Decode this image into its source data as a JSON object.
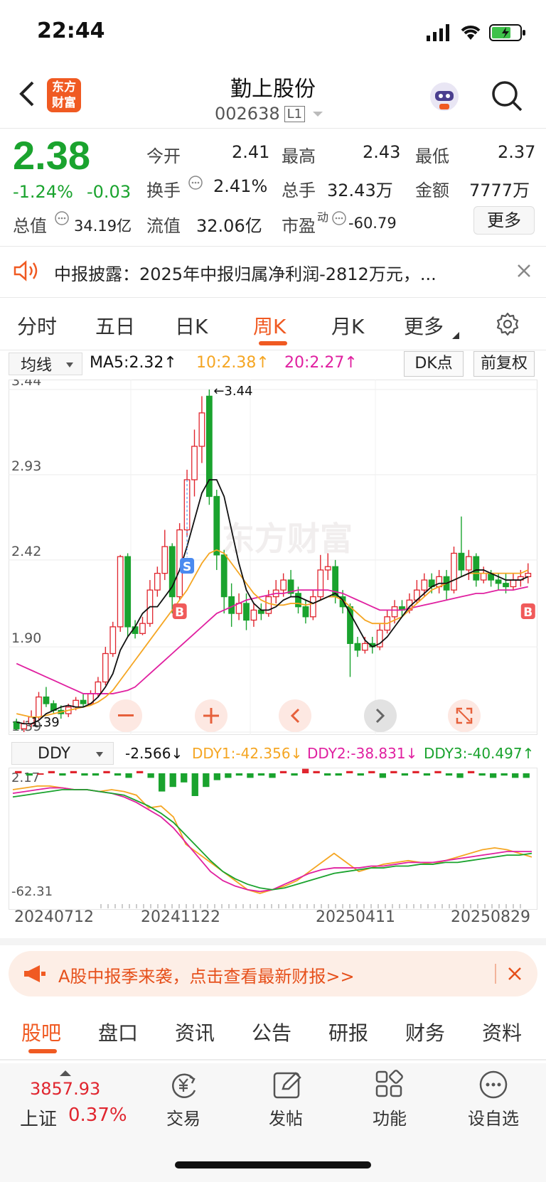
{
  "status_bar": {
    "time": "22:44"
  },
  "header": {
    "title": "勤上股份",
    "code": "002638",
    "level": "L1",
    "logo_line1": "东方",
    "logo_line2": "财富"
  },
  "quote": {
    "price": "2.38",
    "change_pct": "-1.24%",
    "change": "-0.03",
    "open_label": "今开",
    "open": "2.41",
    "high_label": "最高",
    "high": "2.43",
    "low_label": "最低",
    "low": "2.37",
    "turnover_label": "换手",
    "turnover": "2.41%",
    "volume_label": "总手",
    "volume": "32.43万",
    "amount_label": "金额",
    "amount": "7777万",
    "mktcap_label": "总值",
    "mktcap": "34.19亿",
    "float_label": "流值",
    "float": "32.06亿",
    "pe_label": "市盈",
    "pe_sup": "动",
    "pe": "-60.79",
    "more": "更多"
  },
  "notice": {
    "text": "中报披露：2025年中报归属净利润-2812万元，..."
  },
  "chart_tabs": [
    "分时",
    "五日",
    "日K",
    "周K",
    "月K",
    "更多"
  ],
  "active_tab": "周K",
  "ma_bar": {
    "select": "均线",
    "ma5": "MA5:2.32↑",
    "ma10": "10:2.38↑",
    "ma20": "20:2.27↑",
    "dk": "DK点",
    "adjust": "前复权"
  },
  "kline": {
    "y_labels": [
      "3.44",
      "2.93",
      "2.42",
      "1.90",
      "1.39"
    ],
    "high_marker": "←3.44",
    "low_marker": "1.39",
    "watermark": "东方财富",
    "signals": {
      "s": "S",
      "b": "B"
    }
  },
  "ddy_bar": {
    "select": "DDY",
    "ddy": "-2.566↓",
    "ddy1": "DDY1:-42.356↓",
    "ddy2": "DDY2:-38.831↓",
    "ddy3": "DDY3:-40.497↑"
  },
  "ddy_chart": {
    "top": "2.17",
    "bottom": "-62.31"
  },
  "dates": [
    "20240712",
    "20241122",
    "20250411",
    "20250829"
  ],
  "banner": {
    "text": "A股中报季来袭，点击查看最新财报>>"
  },
  "sub_tabs": [
    "股吧",
    "盘口",
    "资讯",
    "公告",
    "研报",
    "财务",
    "资料"
  ],
  "active_sub_tab": "股吧",
  "bottom_nav": {
    "index_value": "3857.93",
    "index_name": "上证",
    "index_change": "0.37%",
    "items": [
      "交易",
      "发帖",
      "功能",
      "设自选"
    ]
  },
  "colors": {
    "up": "#e0262f",
    "down": "#1aa32e",
    "accent": "#f05a22",
    "ma10": "#f5a623",
    "ma20": "#e020a0"
  },
  "chart_data": {
    "type": "candlestick",
    "ylim": [
      1.39,
      3.44
    ],
    "candles": [
      {
        "o": 1.45,
        "c": 1.41,
        "h": 1.47,
        "l": 1.4
      },
      {
        "o": 1.41,
        "c": 1.44,
        "h": 1.46,
        "l": 1.39
      },
      {
        "o": 1.44,
        "c": 1.48,
        "h": 1.52,
        "l": 1.42
      },
      {
        "o": 1.48,
        "c": 1.6,
        "h": 1.63,
        "l": 1.46
      },
      {
        "o": 1.6,
        "c": 1.56,
        "h": 1.66,
        "l": 1.54
      },
      {
        "o": 1.56,
        "c": 1.52,
        "h": 1.58,
        "l": 1.5
      },
      {
        "o": 1.52,
        "c": 1.5,
        "h": 1.55,
        "l": 1.47
      },
      {
        "o": 1.5,
        "c": 1.54,
        "h": 1.56,
        "l": 1.48
      },
      {
        "o": 1.54,
        "c": 1.58,
        "h": 1.6,
        "l": 1.52
      },
      {
        "o": 1.58,
        "c": 1.56,
        "h": 1.62,
        "l": 1.54
      },
      {
        "o": 1.56,
        "c": 1.62,
        "h": 1.64,
        "l": 1.55
      },
      {
        "o": 1.62,
        "c": 1.69,
        "h": 1.72,
        "l": 1.6
      },
      {
        "o": 1.69,
        "c": 1.86,
        "h": 1.9,
        "l": 1.67
      },
      {
        "o": 1.86,
        "c": 2.02,
        "h": 2.05,
        "l": 1.84
      },
      {
        "o": 2.02,
        "c": 2.44,
        "h": 2.45,
        "l": 1.99
      },
      {
        "o": 2.44,
        "c": 2.02,
        "h": 2.46,
        "l": 1.96
      },
      {
        "o": 2.02,
        "c": 1.98,
        "h": 2.06,
        "l": 1.95
      },
      {
        "o": 1.98,
        "c": 2.04,
        "h": 2.08,
        "l": 1.97
      },
      {
        "o": 2.04,
        "c": 2.24,
        "h": 2.3,
        "l": 2.02
      },
      {
        "o": 2.24,
        "c": 2.34,
        "h": 2.38,
        "l": 2.2
      },
      {
        "o": 2.34,
        "c": 2.5,
        "h": 2.6,
        "l": 2.3
      },
      {
        "o": 2.5,
        "c": 2.2,
        "h": 2.52,
        "l": 2.1
      },
      {
        "o": 2.2,
        "c": 2.6,
        "h": 2.64,
        "l": 2.18
      },
      {
        "o": 2.6,
        "c": 2.9,
        "h": 2.96,
        "l": 2.56
      },
      {
        "o": 2.9,
        "c": 3.1,
        "h": 3.2,
        "l": 2.8
      },
      {
        "o": 3.1,
        "c": 3.3,
        "h": 3.4,
        "l": 3.0
      },
      {
        "o": 3.4,
        "c": 2.8,
        "h": 3.44,
        "l": 2.75
      },
      {
        "o": 2.8,
        "c": 2.45,
        "h": 2.84,
        "l": 2.36
      },
      {
        "o": 2.45,
        "c": 2.2,
        "h": 2.48,
        "l": 2.1
      },
      {
        "o": 2.2,
        "c": 2.1,
        "h": 2.28,
        "l": 2.02
      },
      {
        "o": 2.1,
        "c": 2.16,
        "h": 2.22,
        "l": 2.06
      },
      {
        "o": 2.16,
        "c": 2.06,
        "h": 2.22,
        "l": 2.0
      },
      {
        "o": 2.06,
        "c": 2.12,
        "h": 2.16,
        "l": 2.02
      },
      {
        "o": 2.12,
        "c": 2.1,
        "h": 2.16,
        "l": 2.06
      },
      {
        "o": 2.1,
        "c": 2.2,
        "h": 2.24,
        "l": 2.08
      },
      {
        "o": 2.2,
        "c": 2.24,
        "h": 2.3,
        "l": 2.16
      },
      {
        "o": 2.24,
        "c": 2.3,
        "h": 2.34,
        "l": 2.2
      },
      {
        "o": 2.3,
        "c": 2.22,
        "h": 2.36,
        "l": 2.2
      },
      {
        "o": 2.22,
        "c": 2.14,
        "h": 2.26,
        "l": 2.1
      },
      {
        "o": 2.14,
        "c": 2.08,
        "h": 2.18,
        "l": 2.04
      },
      {
        "o": 2.08,
        "c": 2.2,
        "h": 2.24,
        "l": 2.06
      },
      {
        "o": 2.2,
        "c": 2.36,
        "h": 2.45,
        "l": 2.18
      },
      {
        "o": 2.36,
        "c": 2.38,
        "h": 2.46,
        "l": 2.3
      },
      {
        "o": 2.38,
        "c": 2.2,
        "h": 2.42,
        "l": 2.16
      },
      {
        "o": 2.2,
        "c": 2.14,
        "h": 2.24,
        "l": 2.1
      },
      {
        "o": 2.14,
        "c": 1.92,
        "h": 2.16,
        "l": 1.72
      },
      {
        "o": 1.92,
        "c": 1.88,
        "h": 1.96,
        "l": 1.84
      },
      {
        "o": 1.88,
        "c": 1.92,
        "h": 1.96,
        "l": 1.86
      },
      {
        "o": 1.92,
        "c": 1.9,
        "h": 1.96,
        "l": 1.86
      },
      {
        "o": 1.9,
        "c": 2.0,
        "h": 2.04,
        "l": 1.88
      },
      {
        "o": 2.0,
        "c": 2.08,
        "h": 2.12,
        "l": 1.98
      },
      {
        "o": 2.08,
        "c": 2.14,
        "h": 2.18,
        "l": 2.04
      },
      {
        "o": 2.14,
        "c": 2.12,
        "h": 2.18,
        "l": 2.08
      },
      {
        "o": 2.12,
        "c": 2.18,
        "h": 2.22,
        "l": 2.1
      },
      {
        "o": 2.18,
        "c": 2.24,
        "h": 2.3,
        "l": 2.16
      },
      {
        "o": 2.24,
        "c": 2.3,
        "h": 2.34,
        "l": 2.2
      },
      {
        "o": 2.3,
        "c": 2.26,
        "h": 2.34,
        "l": 2.22
      },
      {
        "o": 2.26,
        "c": 2.32,
        "h": 2.36,
        "l": 2.22
      },
      {
        "o": 2.32,
        "c": 2.24,
        "h": 2.36,
        "l": 2.18
      },
      {
        "o": 2.24,
        "c": 2.46,
        "h": 2.5,
        "l": 2.22
      },
      {
        "o": 2.46,
        "c": 2.36,
        "h": 2.68,
        "l": 2.32
      },
      {
        "o": 2.36,
        "c": 2.44,
        "h": 2.48,
        "l": 2.3
      },
      {
        "o": 2.44,
        "c": 2.3,
        "h": 2.46,
        "l": 2.26
      },
      {
        "o": 2.3,
        "c": 2.34,
        "h": 2.38,
        "l": 2.28
      },
      {
        "o": 2.34,
        "c": 2.3,
        "h": 2.36,
        "l": 2.26
      },
      {
        "o": 2.3,
        "c": 2.28,
        "h": 2.34,
        "l": 2.24
      },
      {
        "o": 2.28,
        "c": 2.26,
        "h": 2.34,
        "l": 2.22
      },
      {
        "o": 2.26,
        "c": 2.3,
        "h": 2.34,
        "l": 2.24
      },
      {
        "o": 2.3,
        "c": 2.32,
        "h": 2.36,
        "l": 2.26
      },
      {
        "o": 2.32,
        "c": 2.34,
        "h": 2.4,
        "l": 2.28
      }
    ],
    "ma5": [
      1.45,
      1.44,
      1.44,
      1.46,
      1.5,
      1.52,
      1.54,
      1.55,
      1.54,
      1.54,
      1.56,
      1.6,
      1.66,
      1.74,
      1.88,
      1.96,
      2.02,
      2.1,
      2.14,
      2.14,
      2.2,
      2.26,
      2.36,
      2.5,
      2.66,
      2.82,
      2.9,
      2.9,
      2.8,
      2.6,
      2.4,
      2.24,
      2.16,
      2.12,
      2.12,
      2.14,
      2.18,
      2.2,
      2.2,
      2.18,
      2.16,
      2.18,
      2.2,
      2.22,
      2.18,
      2.1,
      2.02,
      1.94,
      1.9,
      1.92,
      1.96,
      2.02,
      2.08,
      2.14,
      2.18,
      2.22,
      2.26,
      2.28,
      2.28,
      2.3,
      2.32,
      2.34,
      2.36,
      2.36,
      2.34,
      2.32,
      2.3,
      2.3,
      2.3,
      2.32
    ],
    "ma10": [
      1.5,
      1.49,
      1.48,
      1.48,
      1.49,
      1.5,
      1.51,
      1.52,
      1.53,
      1.54,
      1.55,
      1.57,
      1.6,
      1.64,
      1.7,
      1.76,
      1.82,
      1.88,
      1.94,
      2.0,
      2.06,
      2.12,
      2.18,
      2.24,
      2.32,
      2.4,
      2.46,
      2.48,
      2.46,
      2.4,
      2.34,
      2.28,
      2.22,
      2.18,
      2.16,
      2.15,
      2.15,
      2.16,
      2.16,
      2.15,
      2.16,
      2.18,
      2.2,
      2.2,
      2.18,
      2.14,
      2.1,
      2.06,
      2.04,
      2.04,
      2.04,
      2.06,
      2.08,
      2.12,
      2.16,
      2.2,
      2.24,
      2.26,
      2.28,
      2.3,
      2.32,
      2.34,
      2.34,
      2.34,
      2.34,
      2.34,
      2.34,
      2.34,
      2.34,
      2.36
    ],
    "ma20": [
      1.8,
      1.78,
      1.76,
      1.74,
      1.72,
      1.7,
      1.68,
      1.66,
      1.64,
      1.62,
      1.62,
      1.62,
      1.62,
      1.62,
      1.63,
      1.64,
      1.66,
      1.7,
      1.74,
      1.78,
      1.82,
      1.86,
      1.9,
      1.94,
      1.98,
      2.02,
      2.06,
      2.1,
      2.12,
      2.14,
      2.16,
      2.18,
      2.19,
      2.2,
      2.21,
      2.22,
      2.22,
      2.23,
      2.24,
      2.24,
      2.24,
      2.24,
      2.24,
      2.23,
      2.22,
      2.2,
      2.18,
      2.16,
      2.14,
      2.12,
      2.12,
      2.12,
      2.12,
      2.13,
      2.14,
      2.15,
      2.16,
      2.17,
      2.18,
      2.19,
      2.2,
      2.21,
      2.22,
      2.22,
      2.23,
      2.24,
      2.24,
      2.24,
      2.25,
      2.26
    ],
    "ddy_series": [
      {
        "name": "DDY1",
        "values": [
          -5,
          -4,
          -3,
          -3,
          -4,
          -5,
          -5,
          -6,
          -5,
          -6,
          -8,
          -15,
          -14,
          -20,
          -35,
          -40,
          -45,
          -50,
          -55,
          -60,
          -62,
          -60,
          -58,
          -55,
          -50,
          -45,
          -40,
          -45,
          -50,
          -48,
          -46,
          -45,
          -44,
          -45,
          -46,
          -44,
          -42,
          -40,
          -38,
          -37,
          -38,
          -40,
          -42
        ]
      },
      {
        "name": "DDY2",
        "values": [
          -7,
          -6,
          -5,
          -4,
          -4,
          -5,
          -5,
          -6,
          -7,
          -9,
          -12,
          -16,
          -20,
          -26,
          -34,
          -42,
          -50,
          -55,
          -58,
          -60,
          -61,
          -60,
          -57,
          -54,
          -51,
          -49,
          -48,
          -48,
          -48,
          -47,
          -47,
          -46,
          -45,
          -45,
          -45,
          -44,
          -43,
          -42,
          -41,
          -40,
          -39,
          -39,
          -39
        ]
      },
      {
        "name": "DDY3",
        "values": [
          -9,
          -8,
          -7,
          -6,
          -5,
          -5,
          -5,
          -6,
          -7,
          -8,
          -11,
          -14,
          -18,
          -23,
          -30,
          -37,
          -44,
          -50,
          -54,
          -57,
          -59,
          -60,
          -59,
          -57,
          -55,
          -53,
          -51,
          -50,
          -49,
          -48,
          -48,
          -47,
          -47,
          -46,
          -46,
          -45,
          -45,
          -44,
          -43,
          -42,
          -41,
          -41,
          -40
        ]
      }
    ],
    "ddy_bars": [
      1,
      -1,
      0,
      1,
      -1,
      1,
      -1,
      -1,
      1,
      -1,
      -2,
      1,
      -2,
      -8,
      -6,
      -4,
      -10,
      -6,
      -3,
      -2,
      -1,
      -2,
      -1,
      -2,
      1,
      -1,
      2,
      1,
      -1,
      -1,
      1,
      -1,
      1,
      -2,
      1,
      -1,
      1,
      -1,
      1,
      -1,
      -2,
      1,
      -1,
      -2,
      -1,
      -2,
      -2
    ]
  }
}
